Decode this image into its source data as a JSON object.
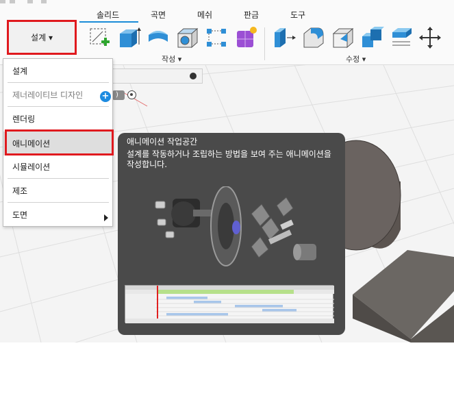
{
  "toolbar": {
    "tabs": [
      "솔리드",
      "곡면",
      "메쉬",
      "판금",
      "도구"
    ],
    "design_button_label": "설계",
    "groups": [
      {
        "label": "작성"
      },
      {
        "label": "수정"
      }
    ],
    "tools_create": [
      "create-sketch-icon",
      "extrude-icon",
      "revolve-icon",
      "shell-icon",
      "pattern-icon",
      "form-icon"
    ],
    "tools_modify": [
      "press-pull-icon",
      "fillet-icon",
      "chamfer-icon",
      "combine-icon",
      "offset-face-icon",
      "move-copy-icon"
    ]
  },
  "dropdown": {
    "items": [
      {
        "label": "설계",
        "state": "normal"
      },
      {
        "label": "제너레이티브 디자인",
        "state": "disabled"
      },
      {
        "label": "렌더링",
        "state": "normal"
      },
      {
        "label": "애니메이션",
        "state": "selected"
      },
      {
        "label": "시뮬레이션",
        "state": "normal"
      },
      {
        "label": "제조",
        "state": "normal"
      },
      {
        "label": "도면",
        "state": "normal"
      }
    ],
    "gen_plus_glyph": "+"
  },
  "browser": {
    "paren_text": ")"
  },
  "tooltip": {
    "title": "애니메이션 작업공간",
    "description": "설계를 작동하거나 조립하는 방법을 보여 주는 애니메이션을 작성합니다."
  },
  "colors": {
    "accent": "#1a8bd8",
    "highlight_red": "#e0191e",
    "tooltip_bg": "#4a4a4a"
  }
}
